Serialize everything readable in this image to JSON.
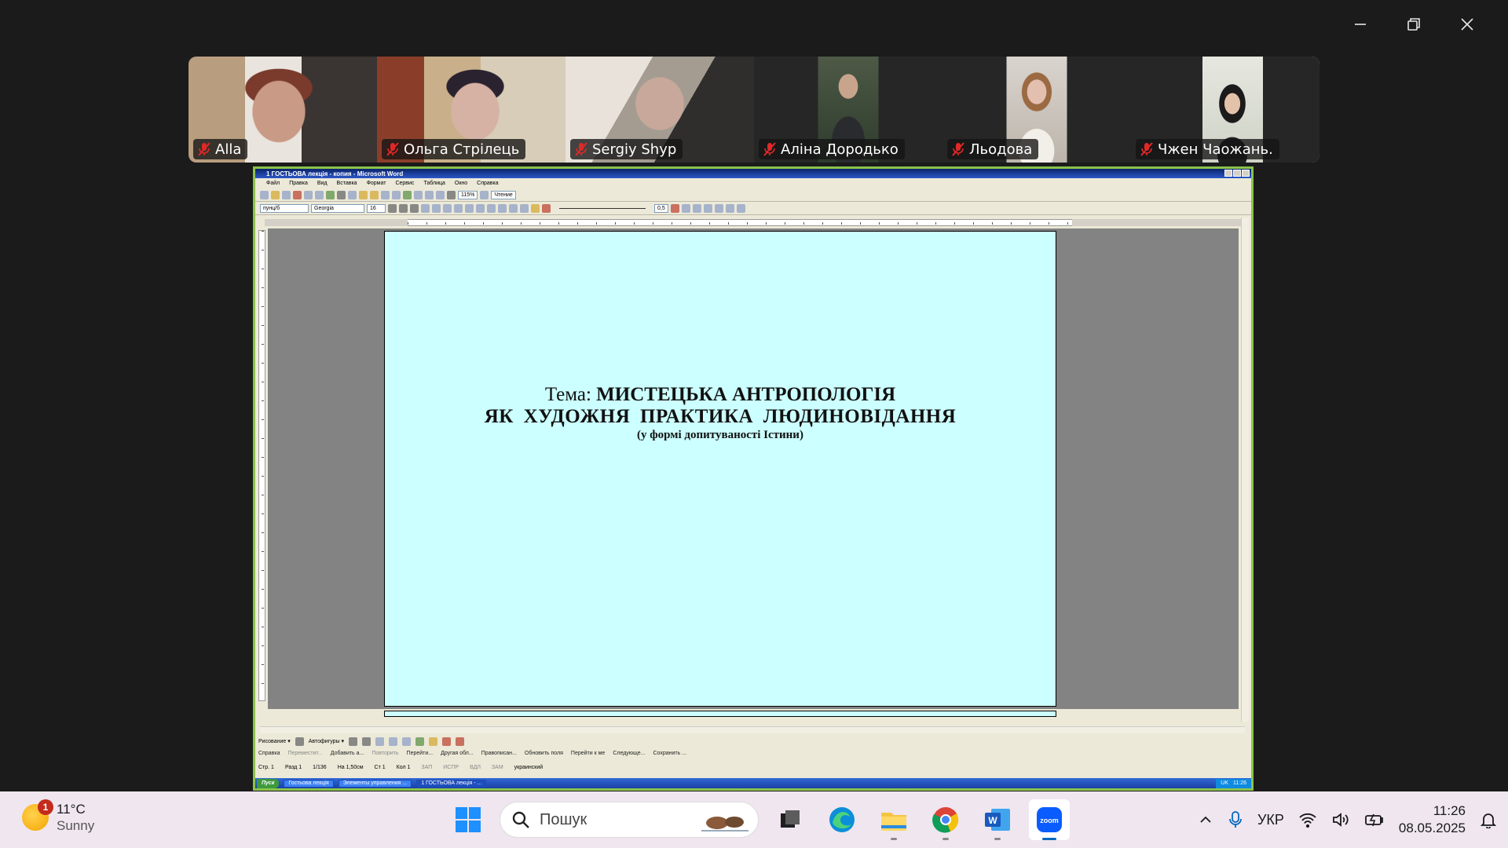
{
  "window": {
    "controls": [
      "minimize",
      "restore",
      "close"
    ]
  },
  "participants": [
    {
      "name": "Alla",
      "muted": true,
      "scene": "#6b5a4a"
    },
    {
      "name": "Ольга Стрілець",
      "muted": true,
      "scene": "#7a5a3e"
    },
    {
      "name": "Sergiy Shyp",
      "muted": true,
      "scene": "#8c8780"
    },
    {
      "name": "Аліна Дородько",
      "muted": true,
      "scene": "#3d3f3a"
    },
    {
      "name": "Льодова",
      "muted": true,
      "scene": "#c9c4bf"
    },
    {
      "name": "Чжен Чаожань.",
      "muted": true,
      "scene": "#d9dbd3"
    }
  ],
  "word": {
    "title": "1 ГОСТЬОВА лекція - копия - Microsoft Word",
    "menu": [
      "Файл",
      "Правка",
      "Вид",
      "Вставка",
      "Формат",
      "Сервис",
      "Таблица",
      "Окно",
      "Справка"
    ],
    "zoom": "115%",
    "reading_btn": "Чтение",
    "style_combo": "пунц/б",
    "font_combo": "Georgia",
    "size_combo": "16",
    "line_weight": "0,5",
    "doc": {
      "line1_plain": "Тема: ",
      "line1_bold": "МИСТЕЦЬКА АНТРОПОЛОГІЯ",
      "line2": "ЯК ХУДОЖНЯ ПРАКТИКА ЛЮДИНОВІДАННЯ",
      "line3": "(у формі допитуваності Істини)"
    },
    "drawing_bar": [
      "Рисование ▾",
      "Автофигуры ▾"
    ],
    "field_bar": [
      "Справка",
      "Переместит...",
      "Добавить а...",
      "Повторить",
      "Перейти...",
      "Другая обл...",
      "Правописан...",
      "Обновить поля",
      "Перейти к ме",
      "Следующе...",
      "Сохранить ..."
    ],
    "status": [
      "Стр. 1",
      "Разд 1",
      "1/136",
      "На 1,50см",
      "Ст 1",
      "Кол 1",
      "ЗАП",
      "ИСПР",
      "ВДЛ",
      "ЗАМ",
      "украинский"
    ],
    "xp_taskbar": {
      "start": "Пуск",
      "tasks": [
        "Гостьова лекція",
        "Элементы управления ...",
        "1 ГОСТЬОВА лекція - ..."
      ],
      "lang": "UK",
      "time": "11:26"
    }
  },
  "taskbar": {
    "weather": {
      "temp": "11°C",
      "desc": "Sunny",
      "badge": "1"
    },
    "search_placeholder": "Пошук",
    "apps": [
      "start-icon",
      "search",
      "task-view-icon",
      "edge-icon",
      "file-explorer-icon",
      "chrome-icon",
      "word-icon",
      "zoom-icon"
    ],
    "lang": "УКР",
    "time": "11:26",
    "date": "08.05.2025"
  },
  "colors": {
    "share_border": "#8bc34a",
    "page_bg": "#ccffff",
    "accent": "#0067c0"
  }
}
